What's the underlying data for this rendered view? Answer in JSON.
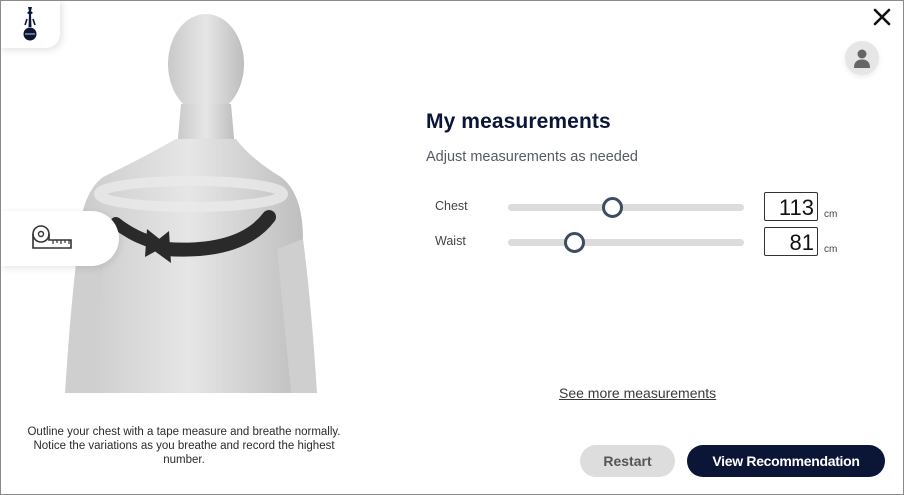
{
  "panel": {
    "title": "My measurements",
    "subtitle": "Adjust measurements as needed"
  },
  "measurements": [
    {
      "label": "Chest",
      "value": "113",
      "unit": "cm",
      "slider_fraction": 0.44
    },
    {
      "label": "Waist",
      "value": "81",
      "unit": "cm",
      "slider_fraction": 0.28
    }
  ],
  "instructions": "Outline your chest with a tape measure and breathe normally. Notice the variations as you breathe and record the highest number.",
  "links": {
    "see_more": "See more measurements"
  },
  "buttons": {
    "restart": "Restart",
    "view_recommendation": "View Recommendation"
  },
  "icons": {
    "logo": "club-crest-icon",
    "close": "close-icon",
    "avatar": "user-icon",
    "tape": "tape-measure-icon"
  },
  "colors": {
    "primary": "#0b1535",
    "track": "#dcdcdc",
    "thumb_border": "#3f4b66",
    "restart_bg": "#dddddd"
  }
}
